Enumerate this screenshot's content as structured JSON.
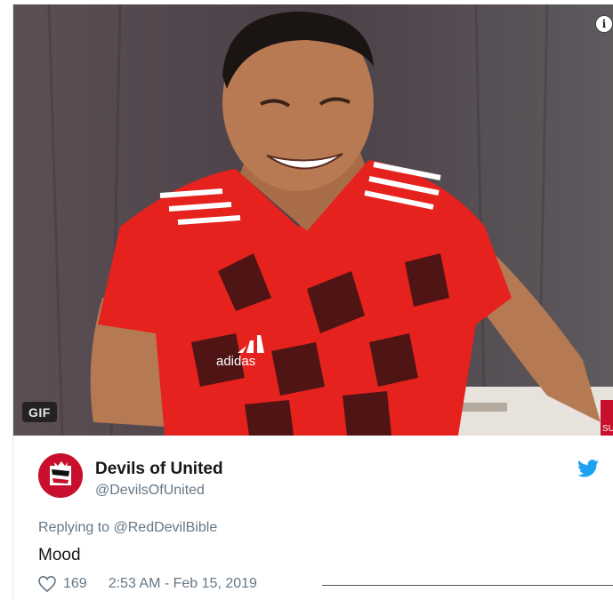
{
  "media": {
    "badge": "GIF",
    "info_glyph": "i",
    "shirt_brand": "adidas",
    "edge_text": "SU"
  },
  "tweet": {
    "display_name": "Devils of United",
    "handle": "@DevilsOfUnited",
    "reply_prefix": "Replying to",
    "reply_to": "@RedDevilBible",
    "text": "Mood",
    "likes": "169",
    "timestamp": "2:53 AM - Feb 15, 2019"
  },
  "icons": {
    "info": "info-icon",
    "brand": "twitter-bird-icon",
    "like": "heart-icon"
  },
  "colors": {
    "twitter_blue": "#1da1f2",
    "text_primary": "#14171a",
    "text_secondary": "#657786",
    "avatar_red": "#c8102e"
  }
}
